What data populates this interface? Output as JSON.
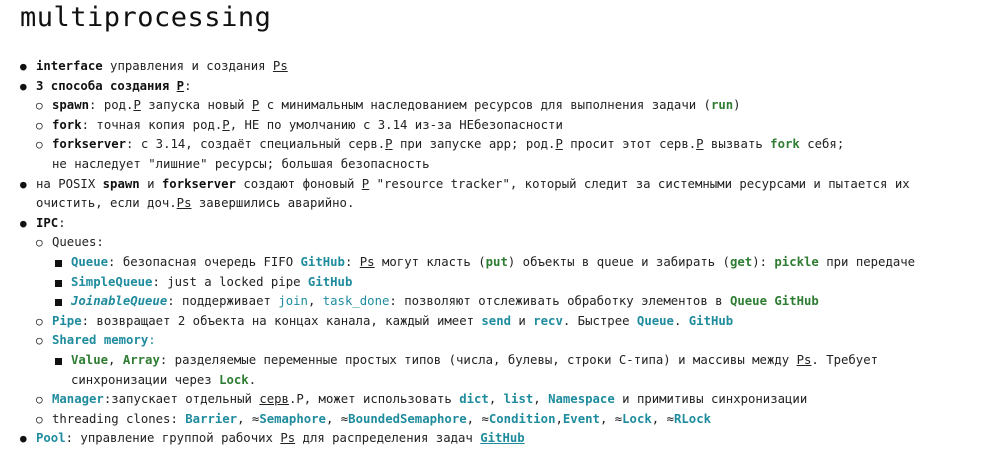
{
  "title": "multiprocessing",
  "l1": {
    "b": "interface",
    "t": " управления и создания ",
    "u": "Ps"
  },
  "l2": {
    "b": "3 способа создания ",
    "u": "P",
    "t": ":"
  },
  "l3": {
    "a": "spawn",
    "b": ": род.",
    "u1": "P",
    "c": " запуска новый ",
    "u2": "P",
    "d": " с минимальным наследованием ресурсов для выполнения задачи (",
    "g": "run",
    "e": ")"
  },
  "l4": {
    "a": "fork",
    "b": ": точная копия род.",
    "u": "P",
    "c": ", НЕ по умолчанию с 3.14 из-за НЕбезопасности"
  },
  "l5": {
    "a": "forkserver",
    "b": ": с 3.14, создаёт специальный серв.",
    "u1": "P",
    "c": " при запуске app; род.",
    "u2": "P",
    "d": " просит этот серв.",
    "u3": "P",
    "e": " вызвать ",
    "g": "fork",
    "f": " себя;"
  },
  "l6": {
    "t": "не наследует \"лишние\" ресурсы; большая безопасность"
  },
  "l7": {
    "a": "на POSIX ",
    "b1": "spawn",
    "b": " и ",
    "b2": "forkserver",
    "c": " создают фоновый ",
    "u": "P",
    "d": " \"resource tracker\", который следит за системными ресурсами и пытается их"
  },
  "l8": {
    "a": "очистить, если доч.",
    "u": "Ps",
    "b": " завершились аварийно."
  },
  "l9": {
    "b": "IPC",
    "t": ":"
  },
  "l10": {
    "t": "Queues:"
  },
  "l11": {
    "q": "Queue",
    "a": ": безопасная очередь FIFO ",
    "gh": "GitHub",
    "b": ": ",
    "u": "Ps",
    "c": " могут класть (",
    "put": "put",
    "d": ") объекты в queue и забирать (",
    "get": "get",
    "e": "): ",
    "pickle": "pickle",
    "f": " при передаче"
  },
  "l12": {
    "q": "SimpleQueue",
    "a": ": just a locked pipe ",
    "gh": "GitHub"
  },
  "l13": {
    "q": "JoinableQueue",
    "a": ": поддерживает ",
    "j": "join",
    "s": ", ",
    "td": "task_done",
    "b": ": позволяют отслеживать обработку элементов в ",
    "g": "Queue",
    "gh": "GitHub"
  },
  "l14": {
    "q": "Pipe",
    "a": ": возвращает 2 объекта на концах канала, каждый имеет ",
    "send": "send",
    "b": " и ",
    "recv": "recv",
    "c": ". Быстрее ",
    "queue": "Queue",
    "d": ". ",
    "gh": "GitHub"
  },
  "l15": {
    "q": "Shared memory",
    "t": ":"
  },
  "l16": {
    "v": "Value",
    "s": ", ",
    "arr": "Array",
    "a": ": разделяемые переменные простых типов (числа, булевы, строки C-типа) и массивы между ",
    "u": "Ps",
    "b": ". Требует"
  },
  "l17": {
    "a": "синхронизации через ",
    "lock": "Lock",
    "b": "."
  },
  "l18": {
    "q": "Manager",
    "a": ":запускает отдельный ",
    "u": "серв",
    "b": ".P, может использовать ",
    "d": "dict",
    "s1": ", ",
    "l": "list",
    "s2": ", ",
    "n": "Namespace",
    "c": " и примитивы синхронизации"
  },
  "l19": {
    "a": "threading clones: ",
    "b1": "Barrier",
    "s1": ", ≈",
    "b2": "Semaphore",
    "s2": ", ≈",
    "b3": "BoundedSemaphore",
    "s3": ", ≈",
    "b4": "Condition",
    "s4": ",",
    "b5": "Event",
    "s5": ", ≈",
    "b6": "Lock",
    "s6": ", ≈",
    "b7": "RLock"
  },
  "l20": {
    "q": "Pool",
    "a": ": управление группой рабочих ",
    "u": "Ps",
    "b": " для распределения задач ",
    "gh": "GitHub"
  },
  "colors": {
    "teal": "#1f8c9e",
    "green": "#2e7d32"
  }
}
